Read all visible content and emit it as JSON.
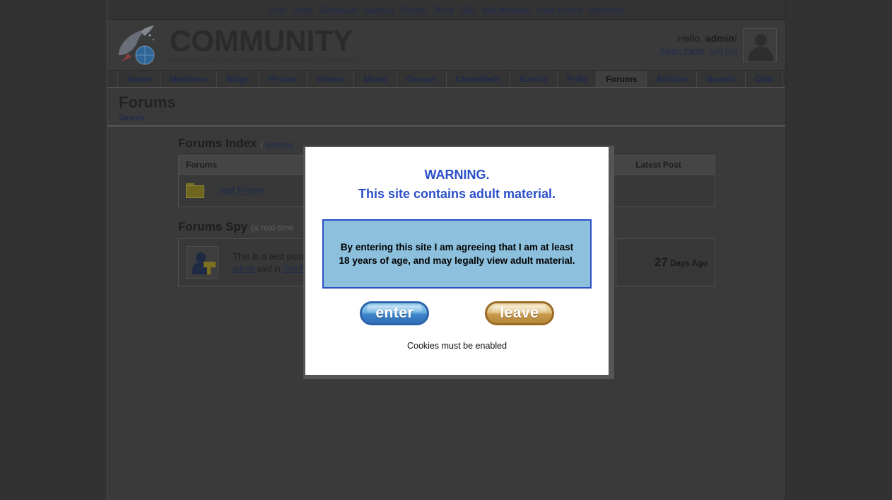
{
  "top_links": [
    {
      "label": "Links"
    },
    {
      "label": "News"
    },
    {
      "label": "Contact Us"
    },
    {
      "label": "About us"
    },
    {
      "label": "Privacy"
    },
    {
      "label": "Terms"
    },
    {
      "label": "FAQ"
    },
    {
      "label": "Add feedback"
    },
    {
      "label": "Invite a friend"
    },
    {
      "label": "Bookmark"
    }
  ],
  "header": {
    "brand_title": "COMMUNITY",
    "brand_subtitle": "POWERED BY DOLPHIN SMART COMMUNITY BUILDER",
    "hello_prefix": "Hello, ",
    "user_name": "admin",
    "hello_suffix": "!",
    "admin_panel_label": "Admin Panel",
    "logout_label": "Log Out"
  },
  "nav": {
    "items": [
      {
        "label": "Home",
        "active": false
      },
      {
        "label": "Members",
        "active": false
      },
      {
        "label": "Blogs",
        "active": false
      },
      {
        "label": "Photos",
        "active": false
      },
      {
        "label": "Videos",
        "active": false
      },
      {
        "label": "Music",
        "active": false
      },
      {
        "label": "Groups",
        "active": false
      },
      {
        "label": "Classifieds",
        "active": false
      },
      {
        "label": "Events",
        "active": false
      },
      {
        "label": "Polls",
        "active": false
      },
      {
        "label": "Forums",
        "active": true
      },
      {
        "label": "Articles",
        "active": false
      },
      {
        "label": "Boards",
        "active": false
      },
      {
        "label": "Chat",
        "active": false
      }
    ]
  },
  "page": {
    "title": "Forums",
    "subnav_search": "Search"
  },
  "forums_index": {
    "heading": "Forums Index",
    "manage_open": "(",
    "manage_label": "Manage",
    "columns": {
      "forums": "Forums",
      "latest_post": "Latest Post"
    },
    "rows": [
      {
        "name": "Test Forum",
        "latest_post": ""
      }
    ]
  },
  "forums_spy": {
    "heading": "Forums Spy",
    "note": "(a real-time",
    "rows": [
      {
        "title": "This is a test post",
        "author": "admin",
        "said_in": " said in ",
        "forum": "Test For",
        "age_number": "27",
        "age_unit": "Days Ago"
      }
    ]
  },
  "modal": {
    "warning_line1": "WARNING.",
    "warning_line2": "This site contains adult material.",
    "agreement_line1": "By entering this site I am agreeing that I am at least",
    "agreement_line2": "18 years of age, and may legally view adult material.",
    "enter_label": "enter",
    "leave_label": "leave",
    "cookie_note": "Cookies must be enabled",
    "warning_color": "#2b50c8",
    "agreement_bg": "#8cc0dd",
    "agreement_border": "#2b50c8"
  }
}
